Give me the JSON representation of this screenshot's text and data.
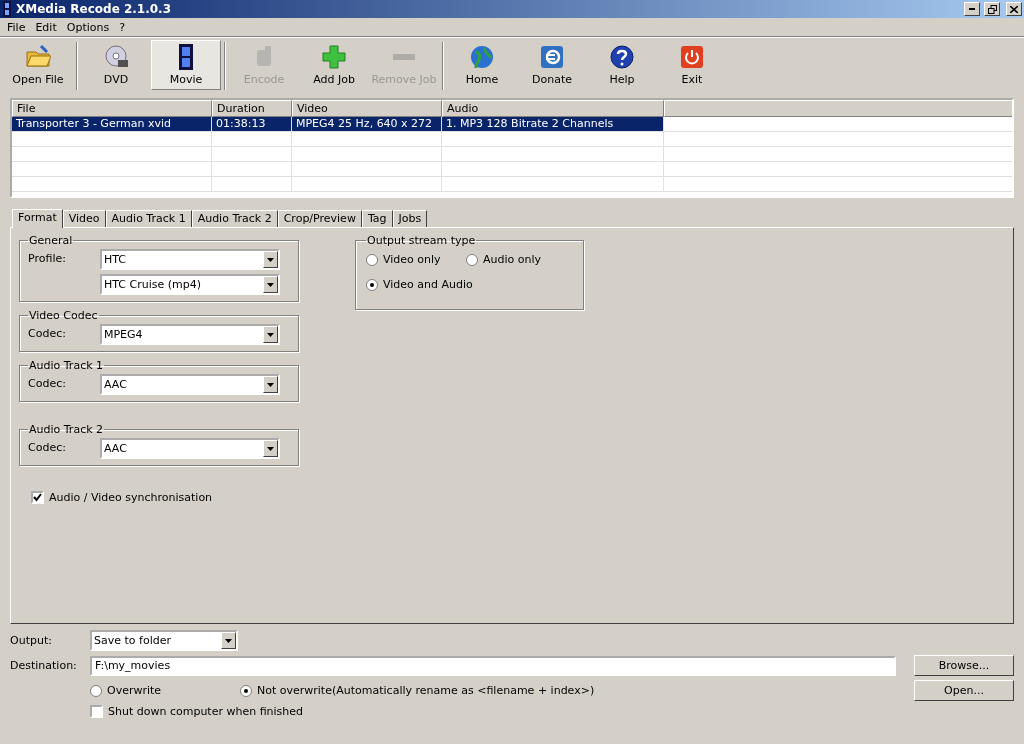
{
  "window": {
    "title": "XMedia Recode 2.1.0.3"
  },
  "menu": [
    "File",
    "Edit",
    "Options",
    "?"
  ],
  "toolbar": [
    {
      "label": "Open File",
      "disabled": false,
      "selected": false
    },
    {
      "label": "DVD",
      "disabled": false,
      "selected": false
    },
    {
      "label": "Movie",
      "disabled": false,
      "selected": true
    },
    {
      "label": "Encode",
      "disabled": true,
      "selected": false
    },
    {
      "label": "Add Job",
      "disabled": false,
      "selected": false
    },
    {
      "label": "Remove Job",
      "disabled": true,
      "selected": false
    },
    {
      "label": "Home",
      "disabled": false,
      "selected": false
    },
    {
      "label": "Donate",
      "disabled": false,
      "selected": false
    },
    {
      "label": "Help",
      "disabled": false,
      "selected": false
    },
    {
      "label": "Exit",
      "disabled": false,
      "selected": false
    }
  ],
  "table": {
    "columns": [
      "File",
      "Duration",
      "Video",
      "Audio"
    ],
    "rows": [
      {
        "selected": true,
        "cells": [
          "Transporter 3 - German xvid",
          "01:38:13",
          "MPEG4 25 Hz, 640 x 272",
          "1. MP3 128 Bitrate 2 Channels"
        ]
      }
    ]
  },
  "tabs": [
    {
      "label": "Format",
      "selected": true
    },
    {
      "label": "Video",
      "selected": false
    },
    {
      "label": "Audio Track 1",
      "selected": false
    },
    {
      "label": "Audio Track 2",
      "selected": false
    },
    {
      "label": "Crop/Preview",
      "selected": false
    },
    {
      "label": "Tag",
      "selected": false
    },
    {
      "label": "Jobs",
      "selected": false
    }
  ],
  "groups": [
    {
      "title": "General",
      "fields": [
        {
          "label": "Profile:",
          "value": "HTC"
        },
        {
          "value": "HTC Cruise (mp4)"
        }
      ]
    },
    {
      "title": "Video Codec",
      "fields": [
        {
          "label": "Codec:",
          "value": "MPEG4"
        }
      ]
    },
    {
      "title": "Audio Track 1",
      "fields": [
        {
          "label": "Codec:",
          "value": "AAC"
        }
      ]
    },
    {
      "title": "Audio Track 2",
      "fields": [
        {
          "label": "Codec:",
          "value": "AAC"
        }
      ]
    }
  ],
  "sync": {
    "label": "Audio / Video synchronisation",
    "checked": true
  },
  "output_stream_type": {
    "title": "Output stream type",
    "options": [
      {
        "label": "Video only",
        "selected": false
      },
      {
        "label": "Audio only",
        "selected": false
      },
      {
        "label": "Video and Audio",
        "selected": true
      }
    ]
  },
  "bottom": {
    "output_label": "Output:",
    "output_value": "Save to folder",
    "destination_label": "Destination:",
    "destination_value": "F:\\my_movies",
    "buttons": [
      "Browse...",
      "Open..."
    ],
    "write_options": [
      {
        "label": "Overwrite",
        "selected": false
      },
      {
        "label": "Not overwrite(Automatically rename as <filename + index>)",
        "selected": true
      }
    ],
    "shutdown": {
      "label": "Shut down computer when finished",
      "checked": false
    }
  }
}
